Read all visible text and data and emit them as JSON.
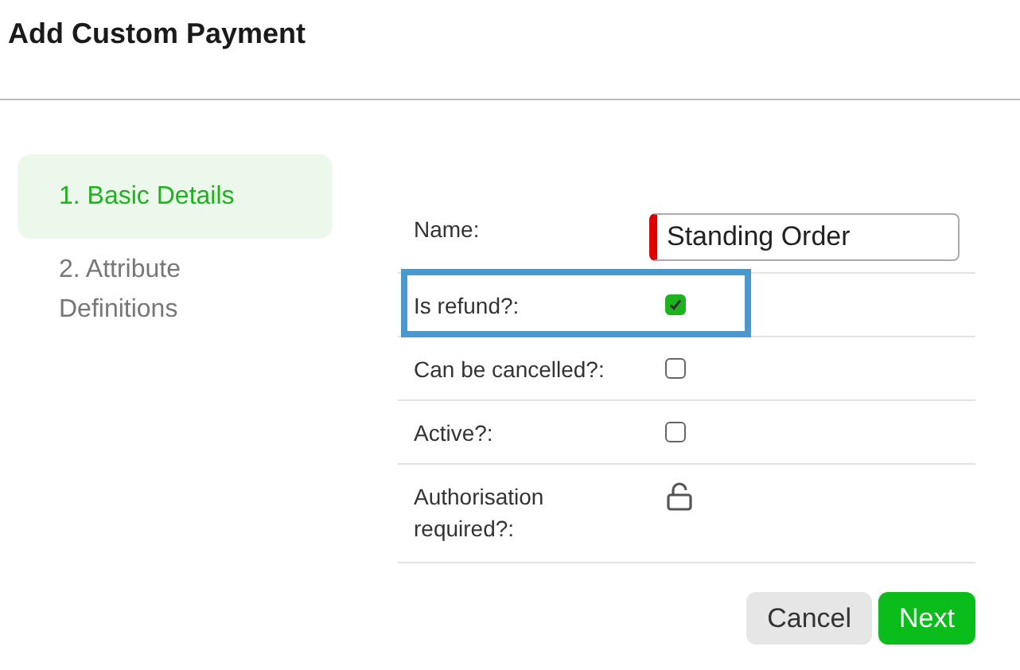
{
  "title": "Add Custom Payment",
  "steps": [
    {
      "label": "1. Basic Details",
      "selected": true
    },
    {
      "label": "2. Attribute Definitions",
      "selected": false
    }
  ],
  "fields": [
    {
      "kind": "text",
      "label": "Name:",
      "value": "Standing Order",
      "required": true,
      "highlighted": false
    },
    {
      "kind": "checkbox",
      "label": "Is refund?:",
      "checked": true,
      "highlighted": true
    },
    {
      "kind": "checkbox",
      "label": "Can be cancelled?:",
      "checked": false,
      "highlighted": false
    },
    {
      "kind": "checkbox",
      "label": "Active?:",
      "checked": false,
      "highlighted": false
    },
    {
      "kind": "lock",
      "label": "Authorisation required?:",
      "locked": false,
      "highlighted": false
    }
  ],
  "buttons": [
    {
      "label": "Cancel",
      "kind": "secondary"
    },
    {
      "label": "Next",
      "kind": "primary"
    }
  ]
}
